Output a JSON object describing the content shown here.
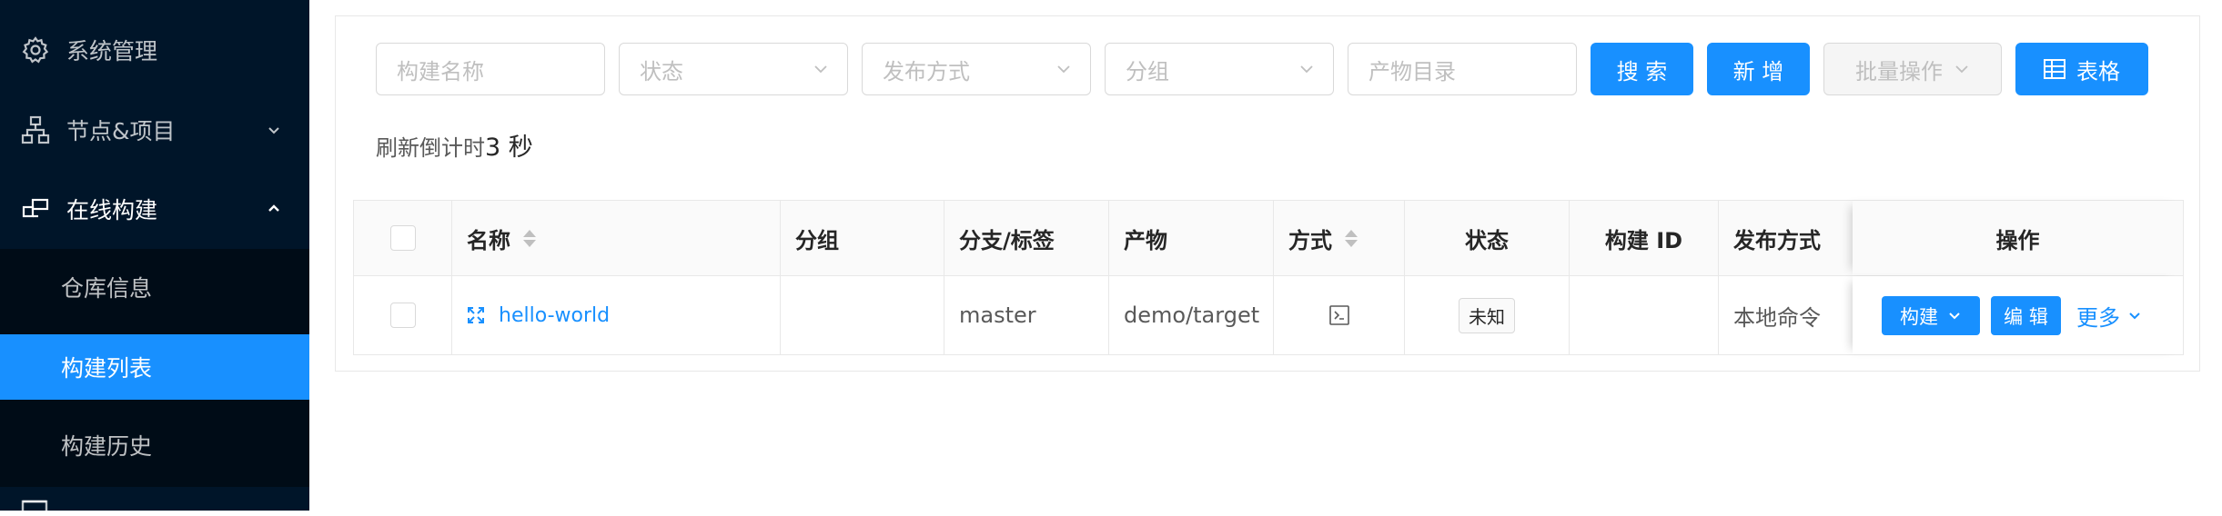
{
  "sidebar": {
    "items": [
      {
        "label": "系统管理",
        "icon": "gear-icon"
      },
      {
        "label": "节点&项目",
        "icon": "sitemap-icon"
      },
      {
        "label": "在线构建",
        "icon": "build-icon"
      }
    ],
    "submenu": [
      {
        "label": "仓库信息"
      },
      {
        "label": "构建列表"
      },
      {
        "label": "构建历史"
      }
    ]
  },
  "filters": {
    "name_placeholder": "构建名称",
    "status_placeholder": "状态",
    "release_method_placeholder": "发布方式",
    "group_placeholder": "分组",
    "product_dir_placeholder": "产物目录"
  },
  "buttons": {
    "search": "搜 索",
    "add": "新 增",
    "batch": "批量操作",
    "table": "表格"
  },
  "countdown": {
    "label": "刷新倒计时",
    "value": "3 秒"
  },
  "table": {
    "columns": [
      "名称",
      "分组",
      "分支/标签",
      "产物",
      "方式",
      "状态",
      "构建 ID",
      "发布方式",
      "操作"
    ],
    "rows": [
      {
        "name": "hello-world",
        "group": "",
        "branch": "master",
        "product": "demo/target",
        "method_icon": "terminal-icon",
        "status": "未知",
        "build_id": "",
        "release_method": "本地命令",
        "actions": {
          "build": "构建",
          "edit": "编 辑",
          "more": "更多"
        }
      }
    ]
  },
  "colors": {
    "sidebar_bg": "#001529",
    "submenu_bg": "#000c17",
    "primary": "#1890ff"
  }
}
